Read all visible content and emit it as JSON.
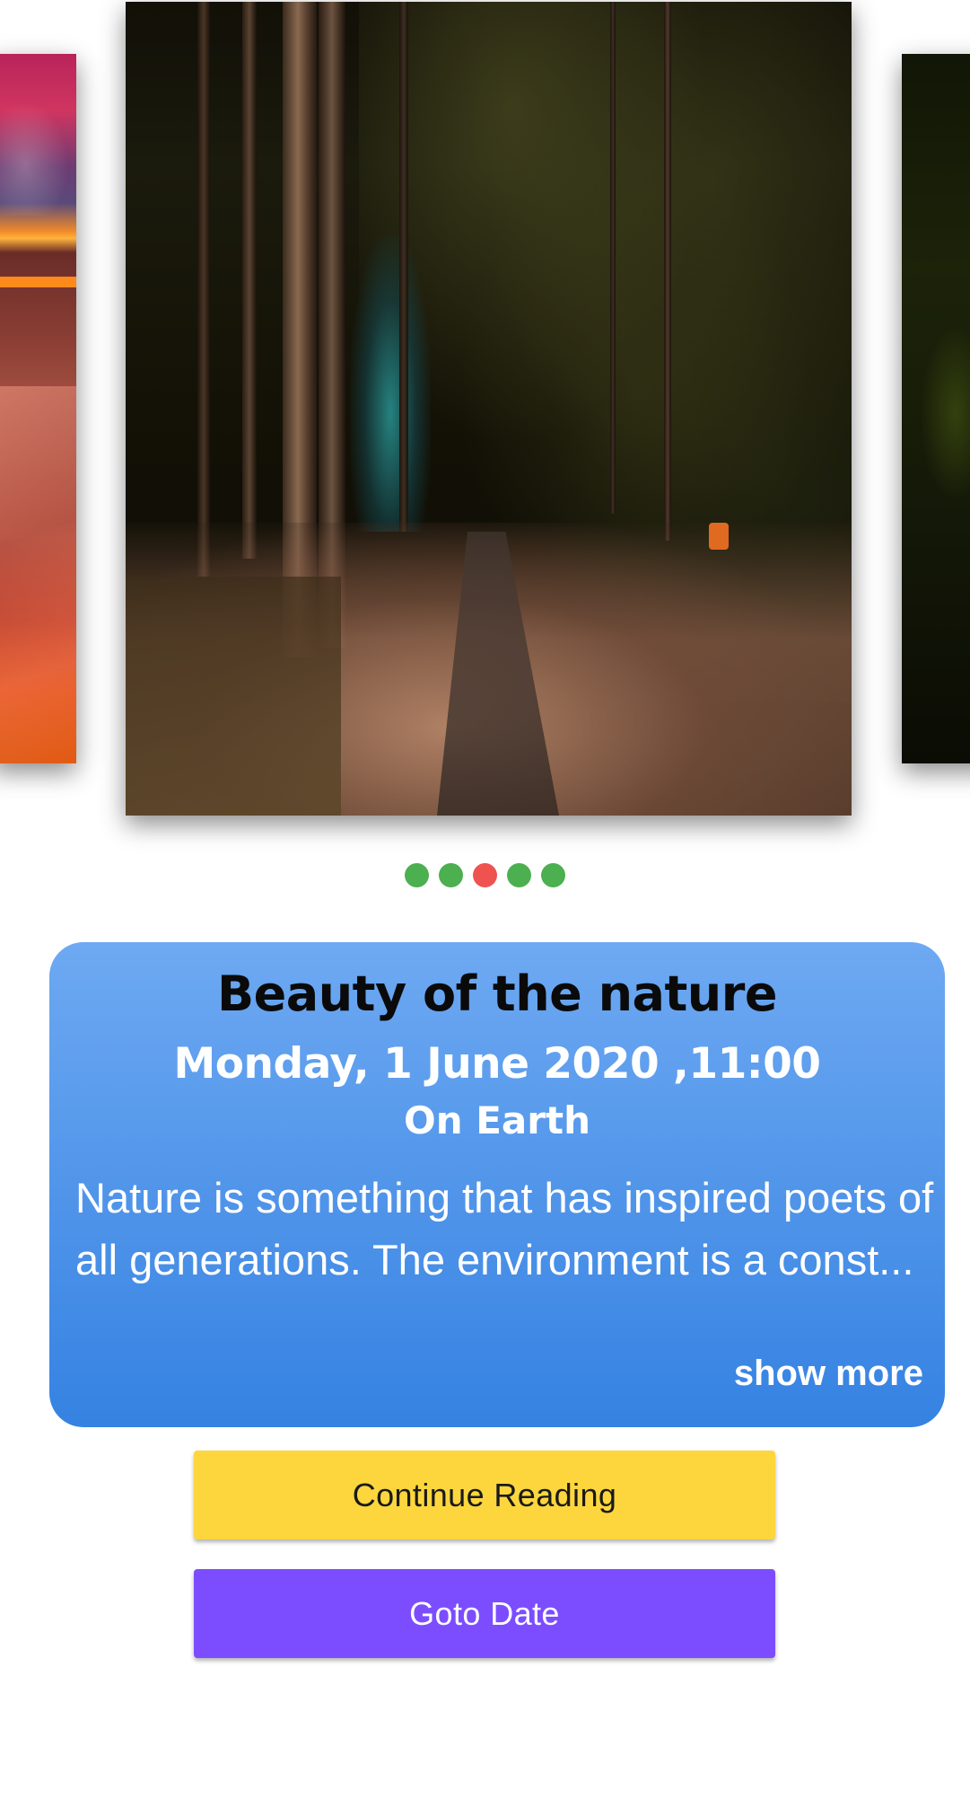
{
  "carousel": {
    "slides": [
      {
        "name": "canyon-sunset-image"
      },
      {
        "name": "forest-path-image"
      },
      {
        "name": "dark-forest-image"
      }
    ],
    "dot_count": 5,
    "active_dot_index": 2,
    "colors": {
      "dot": "#4caf50",
      "dot_active": "#ef5350"
    }
  },
  "card": {
    "title": "Beauty of the nature",
    "date": "Monday, 1 June 2020 ,11:00",
    "location": "On Earth",
    "description": "Nature is something that has inspired poets of all generations. The environment is a const...",
    "show_more": "show more",
    "colors": {
      "gradient_top": "#6ea9f2",
      "gradient_bottom": "#3582e2"
    }
  },
  "buttons": {
    "continue_reading": "Continue Reading",
    "goto_date": "Goto Date",
    "colors": {
      "continue_bg": "#fdd63e",
      "goto_bg": "#7c4dff"
    }
  }
}
